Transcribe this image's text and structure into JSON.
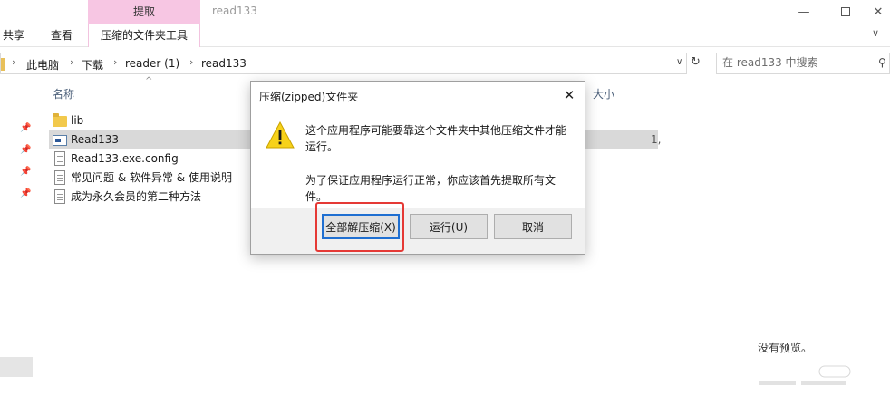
{
  "window": {
    "title": "read133",
    "minimize_glyph": "—",
    "close_glyph": "✕"
  },
  "ribbon": {
    "context_tab_header": "提取",
    "tabs": [
      "共享",
      "查看",
      "压缩的文件夹工具"
    ],
    "expand_glyph": "∨"
  },
  "address": {
    "crumbs": [
      "此电脑",
      "下载",
      "reader (1)",
      "read133"
    ],
    "separator_glyph": "›",
    "dropdown_glyph": "∨",
    "refresh_glyph": "↻",
    "search_placeholder": "在 read133 中搜索",
    "search_glyph": "⚲"
  },
  "filelist": {
    "sort_glyph": "^",
    "columns": {
      "name": "名称",
      "size": "大小"
    },
    "files": [
      {
        "name": "lib",
        "icon": "folder-icon",
        "size": ""
      },
      {
        "name": "Read133",
        "icon": "application-icon",
        "size": "1,",
        "selected": true
      },
      {
        "name": "Read133.exe.config",
        "icon": "document-icon",
        "size": ""
      },
      {
        "name": "常见问题 & 软件异常 & 使用说明",
        "icon": "document-icon",
        "size": ""
      },
      {
        "name": "成为永久会员的第二种方法",
        "icon": "document-icon",
        "size": ""
      }
    ]
  },
  "preview": {
    "empty_text": "没有预览。"
  },
  "dialog": {
    "title": "压缩(zipped)文件夹",
    "close_glyph": "✕",
    "message_1": "这个应用程序可能要靠这个文件夹中其他压缩文件才能运行。",
    "message_2": "为了保证应用程序运行正常，你应该首先提取所有文件。",
    "buttons": {
      "extract_all": "全部解压缩(X)",
      "run": "运行(U)",
      "cancel": "取消"
    },
    "highlight_color": "#e53935"
  },
  "colors": {
    "context_tab": "#f7c6e3",
    "accent": "#1f6fd1",
    "selection": "#d9d9d9"
  }
}
